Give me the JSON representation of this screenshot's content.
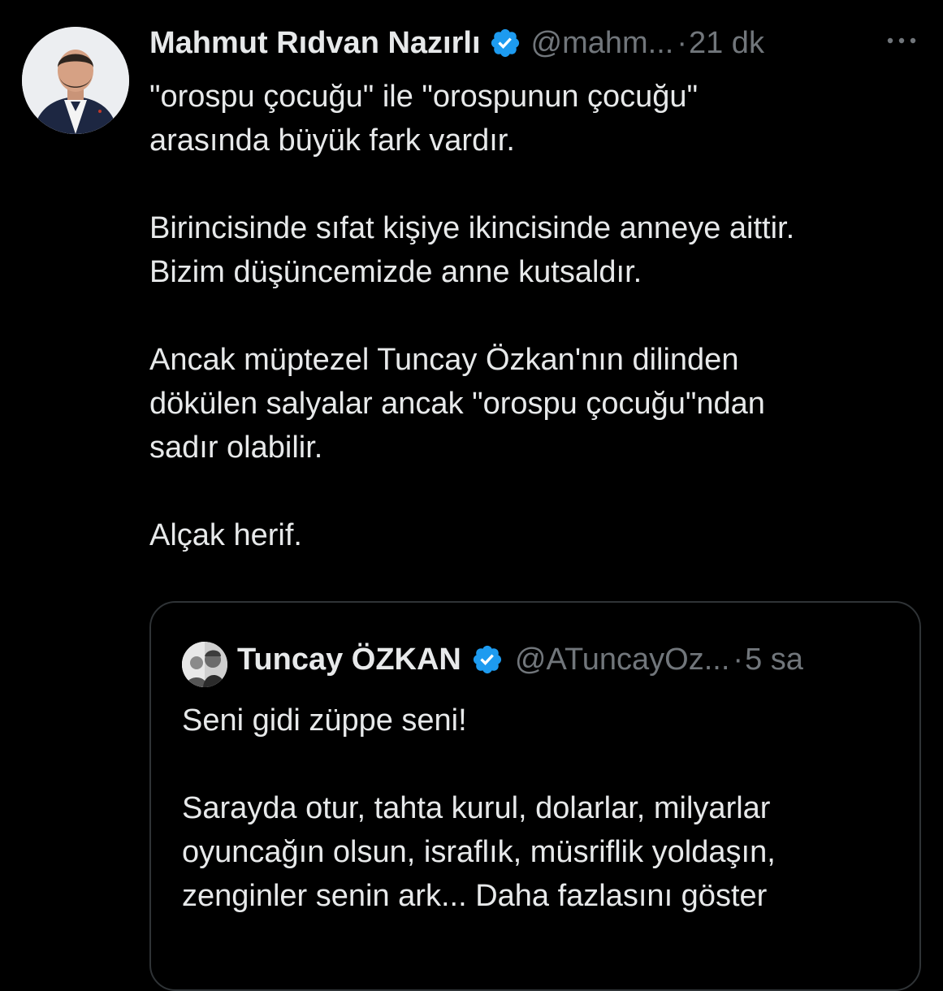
{
  "colors": {
    "background": "#000000",
    "primary_text": "#e7e9ea",
    "secondary_text": "#71767b",
    "verified_badge": "#1d9bf0",
    "border": "#2f3336"
  },
  "tweet": {
    "author": {
      "display_name": "Mahmut Rıdvan Nazırlı",
      "handle": "@mahm...",
      "verified": true,
      "avatar_icon": "profile-photo"
    },
    "separator": "·",
    "time": "21 dk",
    "more_icon": "more-options-icon",
    "text_lines": [
      "\"orospu çocuğu\" ile \"orospunun çocuğu\"",
      "arasında büyük fark vardır.",
      "",
      "Birincisinde sıfat kişiye ikincisinde anneye aittir.",
      "Bizim düşüncemizde anne kutsaldır.",
      "",
      "Ancak müptezel Tuncay Özkan'nın dilinden",
      "dökülen salyalar ancak \"orospu çocuğu\"ndan",
      "sadır olabilir.",
      "",
      "Alçak herif."
    ]
  },
  "quoted_tweet": {
    "author": {
      "display_name": "Tuncay ÖZKAN",
      "handle": "@ATuncayOz...",
      "verified": true,
      "avatar_icon": "profile-photo"
    },
    "separator": "·",
    "time": "5 sa",
    "text_lines": [
      "Seni gidi züppe seni!",
      "",
      "Sarayda otur, tahta kurul, dolarlar, milyarlar",
      "oyuncağın olsun, israflık, müsriflik yoldaşın,",
      "zenginler senin ark..."
    ],
    "show_more_label": "Daha fazlasını göster"
  }
}
